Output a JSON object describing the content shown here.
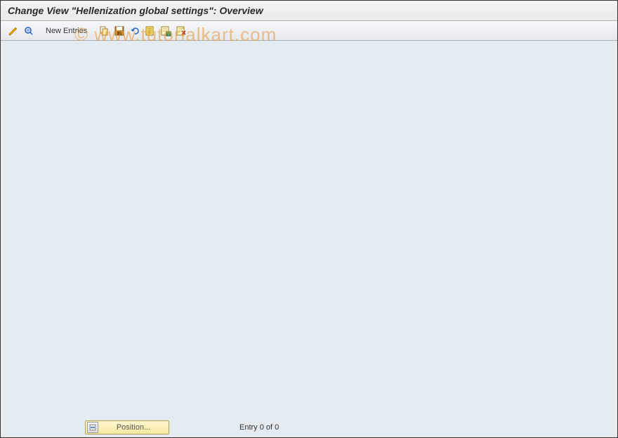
{
  "title": "Change View \"Hellenization global settings\": Overview",
  "toolbar": {
    "new_entries_label": "New Entries"
  },
  "footer": {
    "position_label": "Position...",
    "entry_status": "Entry 0 of 0"
  },
  "watermark": "© www.tutorialkart.com"
}
